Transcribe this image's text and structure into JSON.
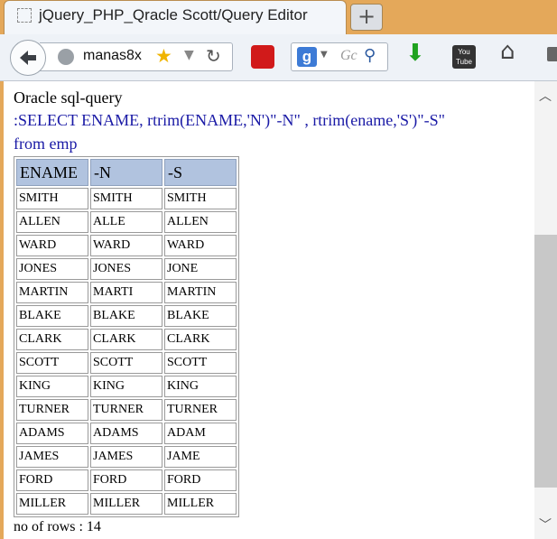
{
  "browser": {
    "tab": {
      "title": "jQuery_PHP_Qracle Scott/Query Editor"
    },
    "new_tab_symbol": "+",
    "address": {
      "url": "manas8x"
    },
    "search": {
      "placeholder": "Gc",
      "engine": "g"
    },
    "youtube_label": "You Tube"
  },
  "page": {
    "heading": "Oracle sql-query",
    "query_line1": ":SELECT ENAME, rtrim(ENAME,'N')\"-N\" , rtrim(ename,'S')\"-S\"",
    "query_line2": "from emp",
    "table": {
      "columns": [
        "ENAME",
        "-N",
        "-S"
      ],
      "rows": [
        [
          "SMITH",
          "SMITH",
          "SMITH"
        ],
        [
          "ALLEN",
          "ALLE",
          "ALLEN"
        ],
        [
          "WARD",
          "WARD",
          "WARD"
        ],
        [
          "JONES",
          "JONES",
          "JONE"
        ],
        [
          "MARTIN",
          "MARTI",
          "MARTIN"
        ],
        [
          "BLAKE",
          "BLAKE",
          "BLAKE"
        ],
        [
          "CLARK",
          "CLARK",
          "CLARK"
        ],
        [
          "SCOTT",
          "SCOTT",
          "SCOTT"
        ],
        [
          "KING",
          "KING",
          "KING"
        ],
        [
          "TURNER",
          "TURNER",
          "TURNER"
        ],
        [
          "ADAMS",
          "ADAMS",
          "ADAM"
        ],
        [
          "JAMES",
          "JAMES",
          "JAME"
        ],
        [
          "FORD",
          "FORD",
          "FORD"
        ],
        [
          "MILLER",
          "MILLER",
          "MILLER"
        ]
      ]
    },
    "footer": "no of rows : 14"
  },
  "colors": {
    "tabstrip": "#e4a85a",
    "header_cell": "#b1c3df",
    "query_text": "#1a1aa6"
  },
  "icons": [
    "page-icon",
    "back-arrow-icon",
    "globe-icon",
    "star-icon",
    "dropdown-icon",
    "reload-icon",
    "youtube-addon-icon",
    "google-icon",
    "magnifier-icon",
    "download-icon",
    "youtube-icon",
    "home-icon"
  ]
}
